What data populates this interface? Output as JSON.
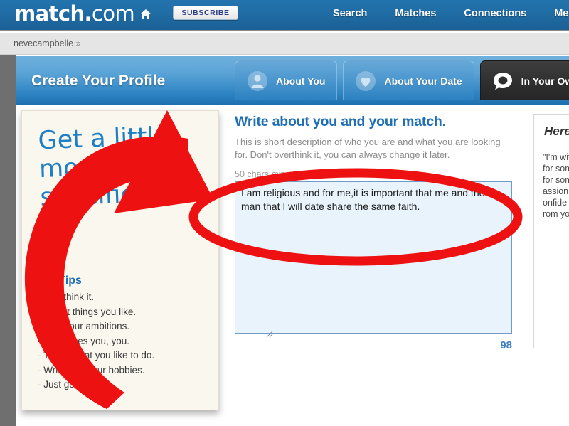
{
  "topbar": {
    "logo_match": "match",
    "logo_dot": ".",
    "logo_com": "com",
    "home_icon": "home-icon",
    "subscribe_label": "SUBSCRIBE",
    "nav": [
      {
        "label": "Search"
      },
      {
        "label": "Matches"
      },
      {
        "label": "Connections"
      },
      {
        "label": "Mess"
      }
    ]
  },
  "breadcrumb": {
    "user": "nevecampbelle",
    "chevron": "»"
  },
  "profile_header": {
    "title": "Create Your Profile",
    "tabs": [
      {
        "label": "About You",
        "icon": "person-icon",
        "active": false
      },
      {
        "label": "About Your Date",
        "icon": "heart-icon",
        "active": false
      },
      {
        "label": "In Your Own W",
        "icon": "speech-bubble-icon",
        "active": true
      }
    ]
  },
  "tips_card": {
    "handwritten_line1": "Get a little",
    "handwritten_line2": "more specific.",
    "heading": "s & Tips",
    "items": [
      "'t overthink it.",
      "e about things you like.",
      "about your ambitions.",
      "-           hat makes you, you.",
      "- Ta        out what you like to do.",
      "- Write      e of your hobbies.",
      "- Just go f"
    ]
  },
  "main": {
    "heading": "Write about you and your match.",
    "description": "This is short description of who you are and what you are looking for. Don't overthink it, you can always change it later.",
    "chars_min": "50 chars min",
    "textarea_value": "I am religious and for me,it is important that me and the man that I will date share the same faith.",
    "textarea_placeholder": "",
    "char_count": "98"
  },
  "example_card": {
    "heading": "Here",
    "quote_lines": [
      "\"I'm wit",
      "for som",
      "for som",
      "assion",
      "onfide",
      "rom yo"
    ]
  },
  "colors": {
    "brand_blue": "#1f6ba3",
    "header_blue": "#2f85c4",
    "link_blue": "#1f6fb5",
    "annotation_red": "#ee1111",
    "textarea_bg": "#e9f3fc",
    "card_cream": "#faf7ee"
  }
}
